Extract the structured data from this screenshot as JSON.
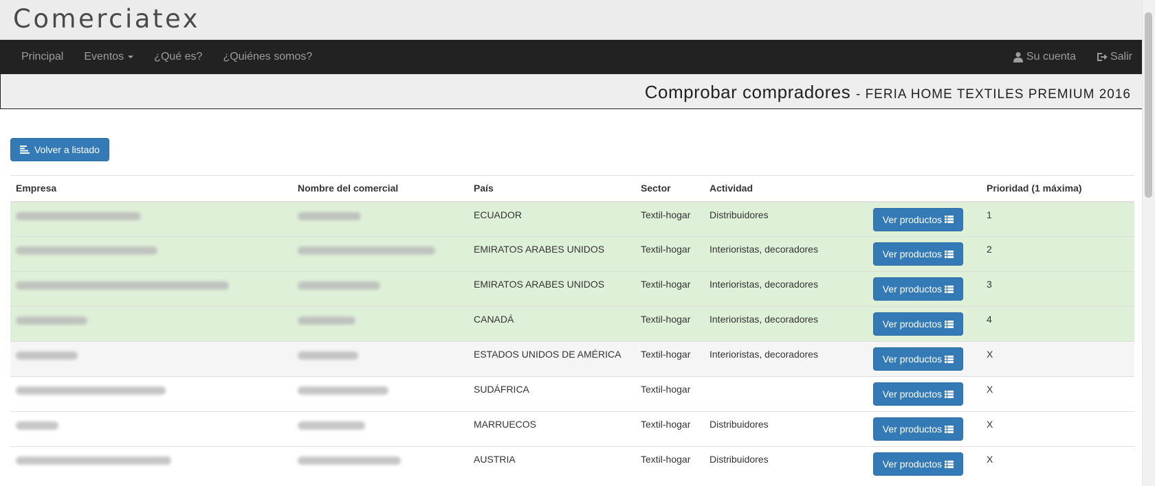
{
  "brand": "Comerciatex",
  "nav": {
    "left": [
      {
        "label": "Principal",
        "dropdown": false
      },
      {
        "label": "Eventos",
        "dropdown": true
      },
      {
        "label": "¿Qué es?",
        "dropdown": false
      },
      {
        "label": "¿Quiénes somos?",
        "dropdown": false
      }
    ],
    "account_label": "Su cuenta",
    "logout_label": "Salir"
  },
  "page": {
    "title": "Comprobar compradores",
    "event": "- FERIA HOME TEXTILES PREMIUM 2016"
  },
  "back_button_label": "Volver a listado",
  "table": {
    "headers": [
      "Empresa",
      "Nombre del comercial",
      "País",
      "Sector",
      "Actividad",
      "",
      "Prioridad (1 máxima)"
    ],
    "button_label": "Ver productos",
    "rows": [
      {
        "pais": "ECUADOR",
        "sector": "Textil-hogar",
        "actividad": "Distribuidores",
        "prioridad": "1",
        "style": "success"
      },
      {
        "pais": "EMIRATOS ARABES UNIDOS",
        "sector": "Textil-hogar",
        "actividad": "Interioristas, decoradores",
        "prioridad": "2",
        "style": "success"
      },
      {
        "pais": "EMIRATOS ARABES UNIDOS",
        "sector": "Textil-hogar",
        "actividad": "Interioristas, decoradores",
        "prioridad": "3",
        "style": "success"
      },
      {
        "pais": "CANADÁ",
        "sector": "Textil-hogar",
        "actividad": "Interioristas, decoradores",
        "prioridad": "4",
        "style": "success"
      },
      {
        "pais": "ESTADOS UNIDOS DE AMÉRICA",
        "sector": "Textil-hogar",
        "actividad": "Interioristas, decoradores",
        "prioridad": "X",
        "style": "active"
      },
      {
        "pais": "SUDÁFRICA",
        "sector": "Textil-hogar",
        "actividad": "",
        "prioridad": "X",
        "style": ""
      },
      {
        "pais": "MARRUECOS",
        "sector": "Textil-hogar",
        "actividad": "Distribuidores",
        "prioridad": "X",
        "style": ""
      },
      {
        "pais": "AUSTRIA",
        "sector": "Textil-hogar",
        "actividad": "Distribuidores",
        "prioridad": "X",
        "style": ""
      }
    ]
  },
  "colors": {
    "primary": "#337ab7",
    "navbar": "#222222",
    "success_row": "#dff0d8",
    "active_row": "#f5f5f5"
  }
}
